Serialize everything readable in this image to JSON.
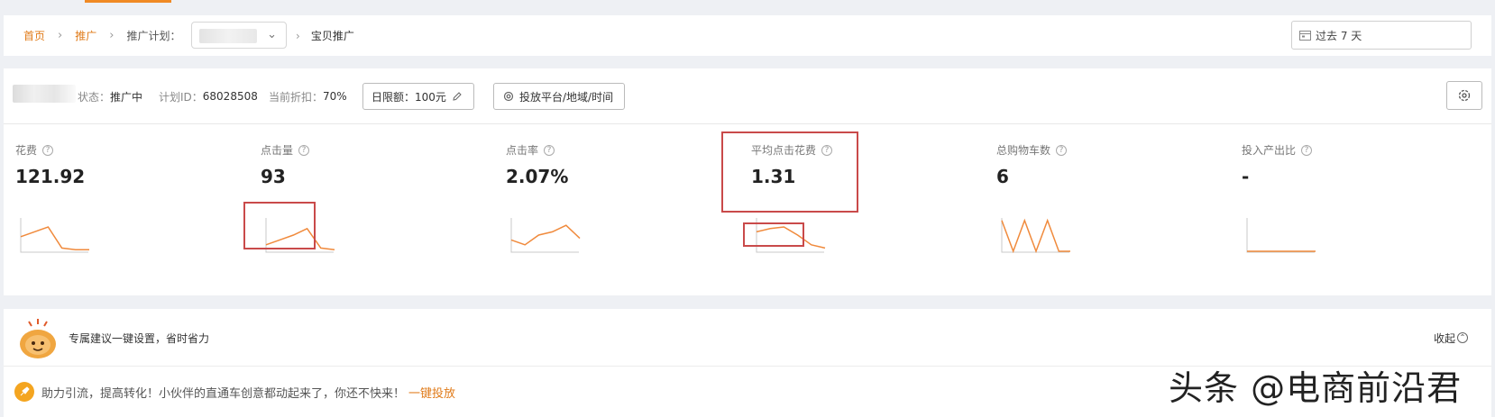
{
  "breadcrumb": {
    "home": "首页",
    "promotion": "推广",
    "plan_label": "推广计划：",
    "current": "宝贝推广"
  },
  "date_range": {
    "value": "过去 7 天",
    "icon": "calendar-icon"
  },
  "plan": {
    "status_label": "状态：",
    "status_value": "推广中",
    "id_label": "计划ID：",
    "id_value": "68028508",
    "discount_label": "当前折扣：",
    "discount_value": "70%",
    "budget_button": "日限额：100元",
    "platform_button": "投放平台/地域/时间"
  },
  "metrics": [
    {
      "label": "花费",
      "value": "121.92",
      "sparkline": [
        0.45,
        0.6,
        0.75,
        0.1,
        0.05,
        0.05
      ]
    },
    {
      "label": "点击量",
      "value": "93",
      "sparkline": [
        0.2,
        0.35,
        0.5,
        0.7,
        0.1,
        0.05
      ]
    },
    {
      "label": "点击率",
      "value": "2.07%",
      "sparkline": [
        0.35,
        0.2,
        0.5,
        0.6,
        0.8,
        0.4
      ]
    },
    {
      "label": "平均点击花费",
      "value": "1.31",
      "sparkline": [
        0.6,
        0.7,
        0.75,
        0.5,
        0.2,
        0.1
      ]
    },
    {
      "label": "总购物车数",
      "value": "6",
      "sparkline": [
        0.95,
        0.0,
        0.95,
        0.0,
        0.95,
        0.0,
        0.0
      ]
    },
    {
      "label": "投入产出比",
      "value": "-",
      "sparkline": [
        0.0,
        0.0,
        0.0,
        0.0,
        0.0,
        0.0
      ]
    }
  ],
  "suggestion": {
    "title": "专属建议一键设置，省时省力",
    "collapse": "收起",
    "message": "助力引流，提高转化！小伙伴的直通车创意都动起来了，你还不快来！",
    "action": "一键投放"
  },
  "watermark": "头条 @电商前沿君",
  "colors": {
    "accent": "#e07b1a",
    "sparkline": "#f08a3c",
    "highlight": "#c94a4a"
  }
}
